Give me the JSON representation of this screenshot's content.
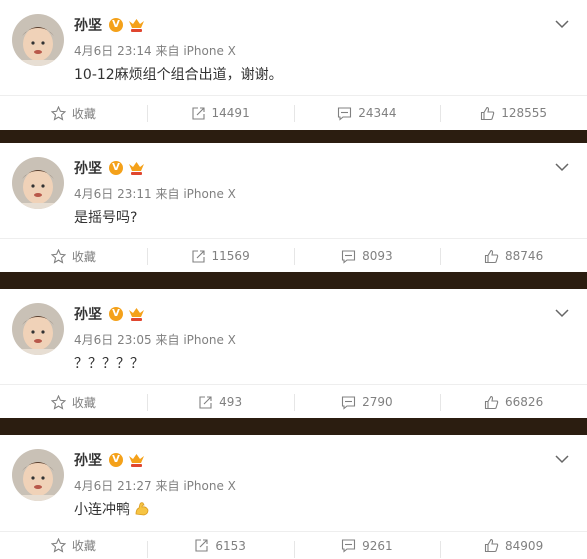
{
  "posts": [
    {
      "username": "孙坚",
      "verified_badge": "V",
      "time": "4月6日 23:14",
      "source": "来自 iPhone X",
      "text": "10-12麻烦组个组合出道，谢谢。",
      "favorite_label": "收藏",
      "reposts": "14491",
      "comments": "24344",
      "likes": "128555"
    },
    {
      "username": "孙坚",
      "verified_badge": "V",
      "time": "4月6日 23:11",
      "source": "来自 iPhone X",
      "text": "是摇号吗?",
      "favorite_label": "收藏",
      "reposts": "11569",
      "comments": "8093",
      "likes": "88746"
    },
    {
      "username": "孙坚",
      "verified_badge": "V",
      "time": "4月6日 23:05",
      "source": "来自 iPhone X",
      "text": "？？？？？",
      "favorite_label": "收藏",
      "reposts": "493",
      "comments": "2790",
      "likes": "66826"
    },
    {
      "username": "孙坚",
      "verified_badge": "V",
      "time": "4月6日 21:27",
      "source": "来自 iPhone X",
      "text": "小连冲鸭",
      "favorite_label": "收藏",
      "reposts": "6153",
      "comments": "9261",
      "likes": "84909"
    }
  ],
  "icons": {
    "favorite": "star-icon",
    "repost": "repost-icon",
    "comment": "comment-icon",
    "like": "thumbs-up-icon",
    "menu": "chevron-down-icon",
    "verified": "verified-v-icon",
    "member": "crown-icon",
    "emoji": "flexed-biceps-emoji"
  },
  "colors": {
    "separator": "#2b1d10",
    "verified_badge": "#f4a11a",
    "text_primary": "#333333",
    "text_secondary": "#808080"
  }
}
